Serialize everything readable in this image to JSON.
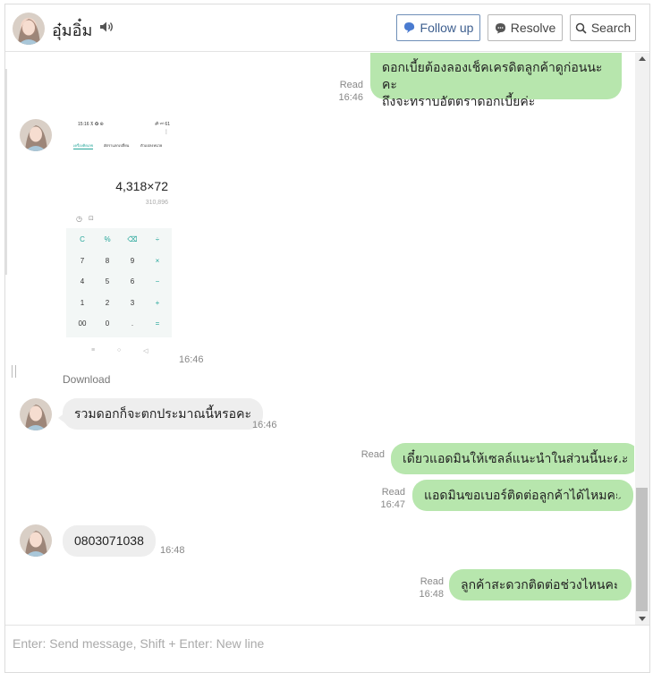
{
  "header": {
    "contact_name": "อุ๋มอิ๋ม",
    "buttons": {
      "follow_up": "Follow up",
      "resolve": "Resolve",
      "search": "Search"
    }
  },
  "messages": [
    {
      "direction": "out",
      "text": "ดอกเบี้ยต้องลองเช็คเครดิตลูกค้าดูก่อนนะคะ",
      "text2": "ถึงจะทราบอัตตราดอกเบี้ยค่ะ",
      "status": "Read",
      "time": "16:46"
    },
    {
      "direction": "in",
      "type": "image",
      "time": "16:46",
      "download_label": "Download",
      "image": {
        "status_left": "15:16 ⊼ ✪ ⊛",
        "status_right": "ॐ ᵛᵒˡ 61",
        "tabs": [
          "เครื่องคิดเลข",
          "อัตราแลกเปลี่ยน",
          "ตัวแปลงหน่วย"
        ],
        "expression": "4,318×72",
        "result": "310,896",
        "keys": [
          "C",
          "%",
          "⌫",
          "÷",
          "7",
          "8",
          "9",
          "×",
          "4",
          "5",
          "6",
          "−",
          "1",
          "2",
          "3",
          "+",
          "00",
          "0",
          ".",
          "="
        ],
        "nav": [
          "≡",
          "○",
          "◁"
        ]
      }
    },
    {
      "direction": "in",
      "text": "รวมดอกก็จะตกประมาณนี้หรอคะ",
      "time": "16:46"
    },
    {
      "direction": "out",
      "text": "เดี๋ยวแอดมินให้เซลล์แนะนำในส่วนนี้นะคะ",
      "status": "Read",
      "time": ""
    },
    {
      "direction": "out",
      "text": "แอดมินขอเบอร์ติดต่อลูกค้าได้ไหมคะ",
      "status": "Read",
      "time": "16:47"
    },
    {
      "direction": "in",
      "text": "0803071038",
      "time": "16:48"
    },
    {
      "direction": "out",
      "text": "ลูกค้าสะดวกติดต่อช่วงไหนคะ",
      "status": "Read",
      "time": "16:48"
    }
  ],
  "composer": {
    "placeholder": "Enter: Send message, Shift + Enter: New line"
  },
  "colors": {
    "outgoing_bubble": "#b7e6ad",
    "incoming_bubble": "#eeeeee",
    "accent": "#3e5f8f",
    "calc_accent": "#26a69a"
  }
}
